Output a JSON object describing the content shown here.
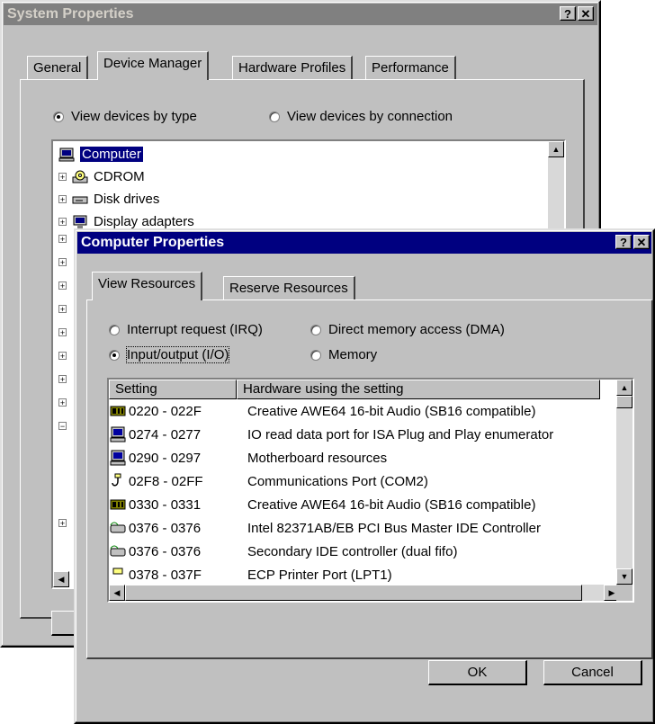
{
  "back_window": {
    "title": "System Properties",
    "help_btn": "?",
    "close_btn": "✕",
    "tabs": [
      "General",
      "Device Manager",
      "Hardware Profiles",
      "Performance"
    ],
    "radio_type": "View devices by type",
    "radio_connection": "View devices by connection",
    "tree": [
      {
        "label": "Computer",
        "icon": "computer-icon"
      },
      {
        "label": "CDROM",
        "icon": "cdrom-icon"
      },
      {
        "label": "Disk drives",
        "icon": "disk-drive-icon"
      },
      {
        "label": "Display adapters",
        "icon": "monitor-icon"
      }
    ]
  },
  "front_window": {
    "title": "Computer Properties",
    "help_btn": "?",
    "close_btn": "✕",
    "tabs": [
      "View Resources",
      "Reserve Resources"
    ],
    "radios": {
      "irq": "Interrupt request (IRQ)",
      "io": "Input/output (I/O)",
      "dma": "Direct memory access (DMA)",
      "memory": "Memory"
    },
    "list_headers": {
      "setting": "Setting",
      "hardware": "Hardware using the setting"
    },
    "rows": [
      {
        "setting": "0220 - 022F",
        "hardware": "Creative AWE64 16-bit Audio (SB16 compatible)",
        "icon": "audio-icon"
      },
      {
        "setting": "0274 - 0277",
        "hardware": "IO read data port for ISA Plug and Play enumerator",
        "icon": "computer-icon"
      },
      {
        "setting": "0290 - 0297",
        "hardware": "Motherboard resources",
        "icon": "computer-icon"
      },
      {
        "setting": "02F8 - 02FF",
        "hardware": "Communications Port (COM2)",
        "icon": "port-icon"
      },
      {
        "setting": "0330 - 0331",
        "hardware": "Creative AWE64 16-bit Audio (SB16 compatible)",
        "icon": "audio-icon"
      },
      {
        "setting": "0376 - 0376",
        "hardware": "Intel 82371AB/EB PCI Bus Master IDE Controller",
        "icon": "ide-controller-icon"
      },
      {
        "setting": "0376 - 0376",
        "hardware": "Secondary IDE controller (dual fifo)",
        "icon": "ide-controller-icon"
      },
      {
        "setting": "0378 - 037F",
        "hardware": "ECP Printer Port (LPT1)",
        "icon": "printer-port-icon"
      }
    ],
    "ok": "OK",
    "cancel": "Cancel"
  }
}
